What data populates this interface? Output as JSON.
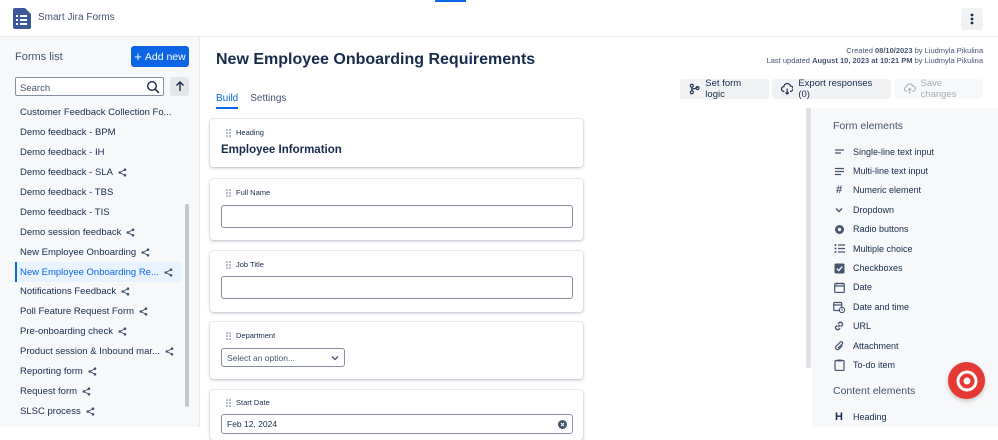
{
  "app": {
    "title": "Smart Jira Forms",
    "logo_icon": "form-list-icon"
  },
  "sidebar": {
    "title": "Forms list",
    "add_button": "Add new",
    "search_placeholder": "Search",
    "items": [
      {
        "label": "Customer Feedback Collection Fo...",
        "shared": false,
        "active": false
      },
      {
        "label": "Demo feedback - BPM",
        "shared": false,
        "active": false
      },
      {
        "label": "Demo feedback - IH",
        "shared": false,
        "active": false
      },
      {
        "label": "Demo feedback - SLA",
        "shared": true,
        "active": false
      },
      {
        "label": "Demo feedback - TBS",
        "shared": false,
        "active": false
      },
      {
        "label": "Demo feedback - TIS",
        "shared": false,
        "active": false
      },
      {
        "label": "Demo session feedback",
        "shared": true,
        "active": false
      },
      {
        "label": "New Employee Onboarding",
        "shared": true,
        "active": false
      },
      {
        "label": "New Employee Onboarding Re...",
        "shared": true,
        "active": true
      },
      {
        "label": "Notifications Feedback",
        "shared": true,
        "active": false
      },
      {
        "label": "Poll Feature Request Form",
        "shared": true,
        "active": false
      },
      {
        "label": "Pre-onboarding check",
        "shared": true,
        "active": false
      },
      {
        "label": "Product session & Inbound mar...",
        "shared": true,
        "active": false
      },
      {
        "label": "Reporting form",
        "shared": true,
        "active": false
      },
      {
        "label": "Request form",
        "shared": true,
        "active": false
      },
      {
        "label": "SLSC process",
        "shared": true,
        "active": false
      }
    ]
  },
  "main": {
    "title": "New Employee Onboarding Requirements",
    "meta": {
      "created_prefix": "Created",
      "created_date": "08/10/2023",
      "created_by": "by Liudmyla Pikulina",
      "updated_prefix": "Last updated",
      "updated_date": "August 10, 2023 at 10:21 PM",
      "updated_by": "by Liudmyla Pikulina"
    },
    "tabs": [
      {
        "label": "Build"
      },
      {
        "label": "Settings"
      }
    ],
    "toolbar": {
      "logic": "Set form logic",
      "export": "Export responses (0)",
      "save": "Save changes"
    },
    "fields": {
      "heading_label": "Heading",
      "heading_text": "Employee Information",
      "full_name_label": "Full Name",
      "job_title_label": "Job Title",
      "department_label": "Department",
      "department_placeholder": "Select an option...",
      "start_date_label": "Start Date",
      "start_date_value": "Feb 12, 2024"
    }
  },
  "right_panel": {
    "form_elements_title": "Form elements",
    "form_elements": [
      {
        "label": "Single-line text input",
        "icon": "single-line-icon"
      },
      {
        "label": "Multi-line text input",
        "icon": "multi-line-icon"
      },
      {
        "label": "Numeric element",
        "icon": "hash-icon"
      },
      {
        "label": "Dropdown",
        "icon": "chevron-down-icon"
      },
      {
        "label": "Radio buttons",
        "icon": "radio-icon"
      },
      {
        "label": "Multiple choice",
        "icon": "list-icon"
      },
      {
        "label": "Checkboxes",
        "icon": "checkbox-icon"
      },
      {
        "label": "Date",
        "icon": "calendar-icon"
      },
      {
        "label": "Date and time",
        "icon": "calendar-clock-icon"
      },
      {
        "label": "URL",
        "icon": "link-icon"
      },
      {
        "label": "Attachment",
        "icon": "paperclip-icon"
      },
      {
        "label": "To-do item",
        "icon": "todo-icon"
      }
    ],
    "content_elements_title": "Content elements",
    "content_elements": [
      {
        "label": "Heading",
        "icon": "heading-icon"
      }
    ]
  },
  "colors": {
    "accent": "#0c66e4",
    "help_button": "#e53935"
  }
}
